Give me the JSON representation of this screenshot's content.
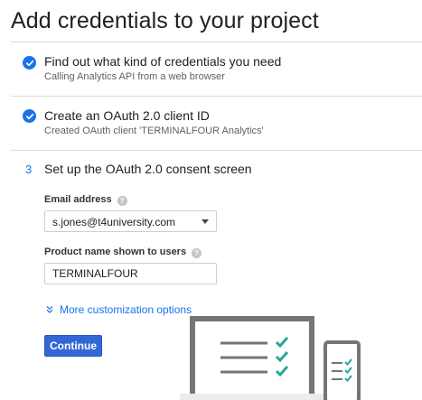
{
  "page": {
    "title": "Add credentials to your project"
  },
  "steps": [
    {
      "status": "complete",
      "icon": "check-circle-icon",
      "title": "Find out what kind of credentials you need",
      "subtitle": "Calling Analytics API from a web browser"
    },
    {
      "status": "complete",
      "icon": "check-circle-icon",
      "title": "Create an OAuth 2.0 client ID",
      "subtitle": "Created OAuth client 'TERMINALFOUR Analytics'"
    },
    {
      "status": "active",
      "number": "3",
      "title": "Set up the OAuth 2.0 consent screen"
    }
  ],
  "form": {
    "email_label": "Email address",
    "email_value": "s.jones@t4university.com",
    "product_label": "Product name shown to users",
    "product_value": "TERMINALFOUR",
    "help_glyph": "?",
    "more_options_label": "More customization options",
    "continue_label": "Continue"
  },
  "colors": {
    "accent": "#1a73e8",
    "button": "#3367d6",
    "check_green": "#26a69a",
    "illustration_gray": "#757575"
  }
}
